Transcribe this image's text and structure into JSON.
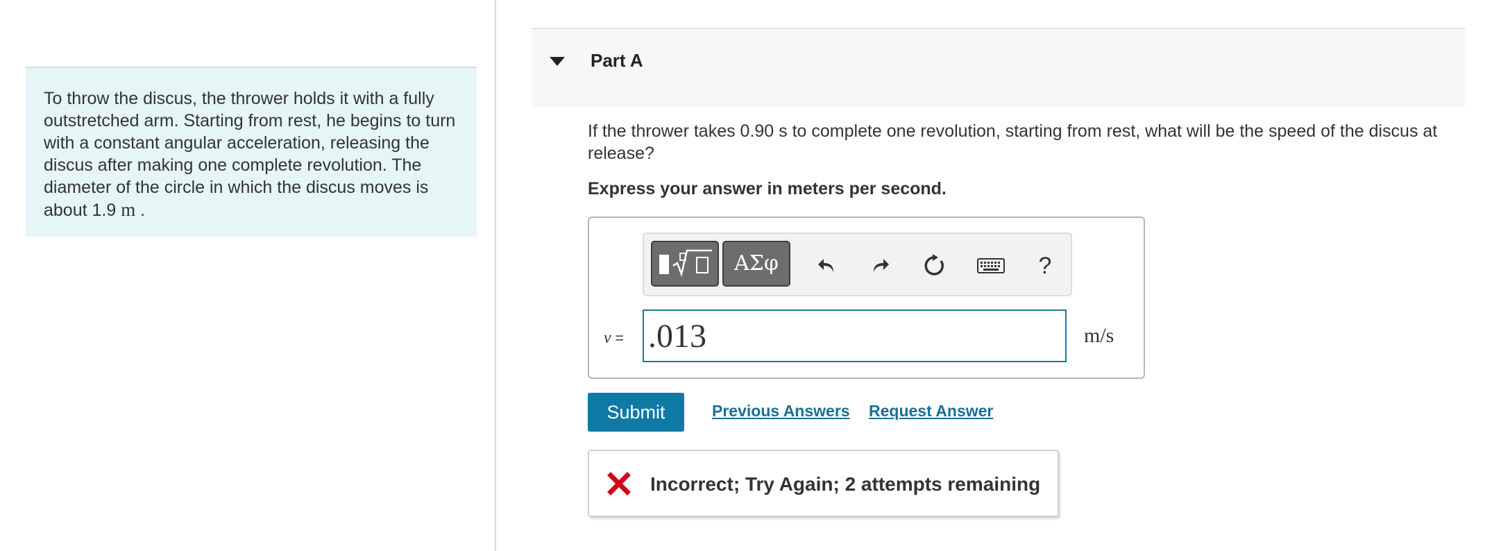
{
  "problem": {
    "text": "To throw the discus, the thrower holds it with a fully outstretched arm. Starting from rest, he begins to turn with a constant angular acceleration, releasing the discus after making one complete revolution. The diameter of the circle in which the discus moves is about 1.9 ",
    "unit": "m",
    "end": " ."
  },
  "part": {
    "title": "Part A",
    "question": "If the thrower takes 0.90  s to complete one revolution, starting from rest, what will be the speed of the discus at release?",
    "instruction": "Express your answer in meters per second."
  },
  "toolbar": {
    "templates_icon": "templates-sqrt-icon",
    "greek_label": "ΑΣφ",
    "undo_icon": "undo-icon",
    "redo_icon": "redo-icon",
    "reset_icon": "reset-icon",
    "keyboard_icon": "keyboard-icon",
    "help_label": "?"
  },
  "answer": {
    "variable": "v",
    "equals": "=",
    "value": ".013",
    "unit": "m/s"
  },
  "actions": {
    "submit_label": "Submit",
    "previous_answers_label": "Previous Answers",
    "request_answer_label": "Request Answer"
  },
  "feedback": {
    "icon": "x-mark-icon",
    "text": "Incorrect; Try Again; 2 attempts remaining"
  },
  "colors": {
    "accent": "#0e7aa5",
    "link": "#1a6e96",
    "error": "#d0021b",
    "intro_bg": "#e6f5f6"
  }
}
